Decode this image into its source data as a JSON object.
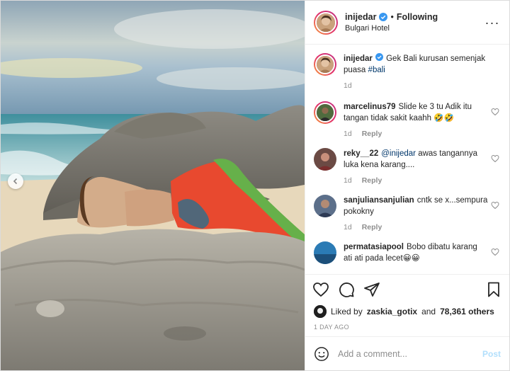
{
  "post": {
    "username": "inijedar",
    "separator": "•",
    "follow_state": "Following",
    "location": "Bulgari Hotel",
    "more_icon": "more-horizontal-icon"
  },
  "caption": {
    "username": "inijedar",
    "text": "Gek Bali kurusan semenjak puasa",
    "hashtag": "#bali",
    "age": "1d"
  },
  "comments": [
    {
      "username": "marcelinus79",
      "mention": "",
      "text": "Slide ke 3 tu Adik itu tangan tidak sakit kaahh 🤣🤣",
      "age": "1d",
      "reply": "Reply"
    },
    {
      "username": "reky__22",
      "mention": "@inijedar",
      "text": " awas tangannya luka kena karang....",
      "age": "1d",
      "reply": "Reply"
    },
    {
      "username": "sanjuliansanjulian",
      "mention": "",
      "text": "cntk se x...sempura pokokny",
      "age": "1d",
      "reply": "Reply"
    },
    {
      "username": "permatasiapool",
      "mention": "",
      "text": "Bobo dibatu karang ati ati pada lecet😀😀",
      "age": "",
      "reply": ""
    }
  ],
  "likes": {
    "prefix": "Liked by",
    "user": "zaskia_gotix",
    "middle": "and",
    "others": "78,361 others"
  },
  "date": "1 DAY AGO",
  "add_comment": {
    "placeholder": "Add a comment...",
    "post_label": "Post"
  },
  "colors": {
    "verified": "#3897f0",
    "link": "#00376b",
    "post_disabled": "#b2dffc",
    "muted": "#8e8e8e"
  }
}
